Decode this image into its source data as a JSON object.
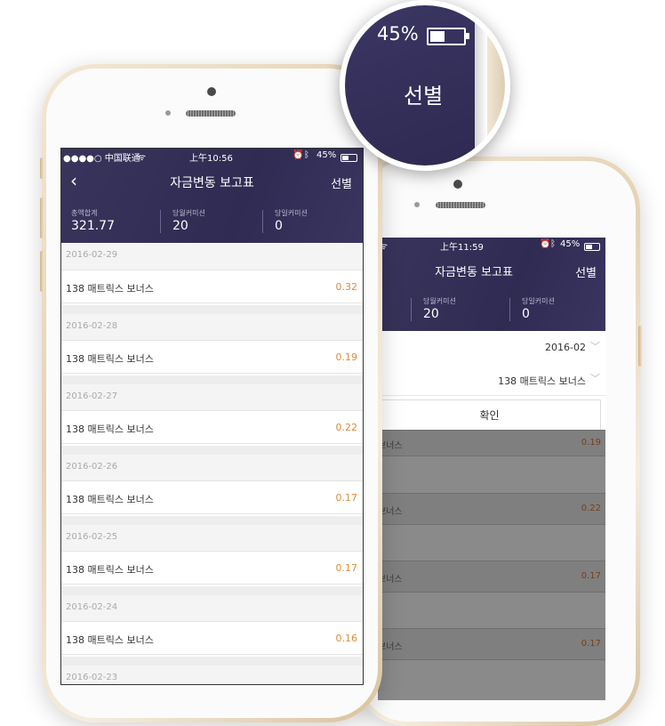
{
  "front": {
    "status": {
      "carrier": "●●●●○ 中国联通",
      "wifi_icon": "wifi-icon",
      "time": "上午10:56",
      "battery": "45%"
    },
    "header": {
      "title": "자금변동 보고표",
      "filter_label": "선별",
      "back_icon": "chevron-left-icon"
    },
    "stats": [
      {
        "label": "총액합계",
        "value": "321.77"
      },
      {
        "label": "당월커미션",
        "value": "20"
      },
      {
        "label": "당일커미션",
        "value": "0"
      }
    ],
    "entries": [
      {
        "date": "2016-02-29",
        "name": "138 매트릭스 보너스",
        "amount": "0.32"
      },
      {
        "date": "2016-02-28",
        "name": "138 매트릭스 보너스",
        "amount": "0.19"
      },
      {
        "date": "2016-02-27",
        "name": "138 매트릭스 보너스",
        "amount": "0.22"
      },
      {
        "date": "2016-02-26",
        "name": "138 매트릭스 보너스",
        "amount": "0.17"
      },
      {
        "date": "2016-02-25",
        "name": "138 매트릭스 보너스",
        "amount": "0.17"
      },
      {
        "date": "2016-02-24",
        "name": "138 매트릭스 보너스",
        "amount": "0.16"
      },
      {
        "date": "2016-02-23",
        "name": "",
        "amount": ""
      }
    ]
  },
  "back": {
    "status": {
      "time": "上午11:59",
      "battery": "45%"
    },
    "header": {
      "title": "자금변동 보고표",
      "filter_label": "선별"
    },
    "stats": [
      {
        "label": "당월커미션",
        "value": "20"
      },
      {
        "label": "당일커미션",
        "value": "0"
      }
    ],
    "filter": {
      "month": "2016-02",
      "type": "138 매트릭스 보너스",
      "confirm": "확인"
    },
    "dimmed_rows": [
      {
        "name": "보너스",
        "amount": "0.19"
      },
      {
        "name": "보너스",
        "amount": "0.22"
      },
      {
        "name": "보너스",
        "amount": "0.17"
      },
      {
        "name": "보너스",
        "amount": "0.17"
      }
    ]
  },
  "zoom": {
    "battery": "45%",
    "filter_label": "선별"
  },
  "colors": {
    "header": "#2f2b53",
    "amount": "#e08a3a"
  }
}
